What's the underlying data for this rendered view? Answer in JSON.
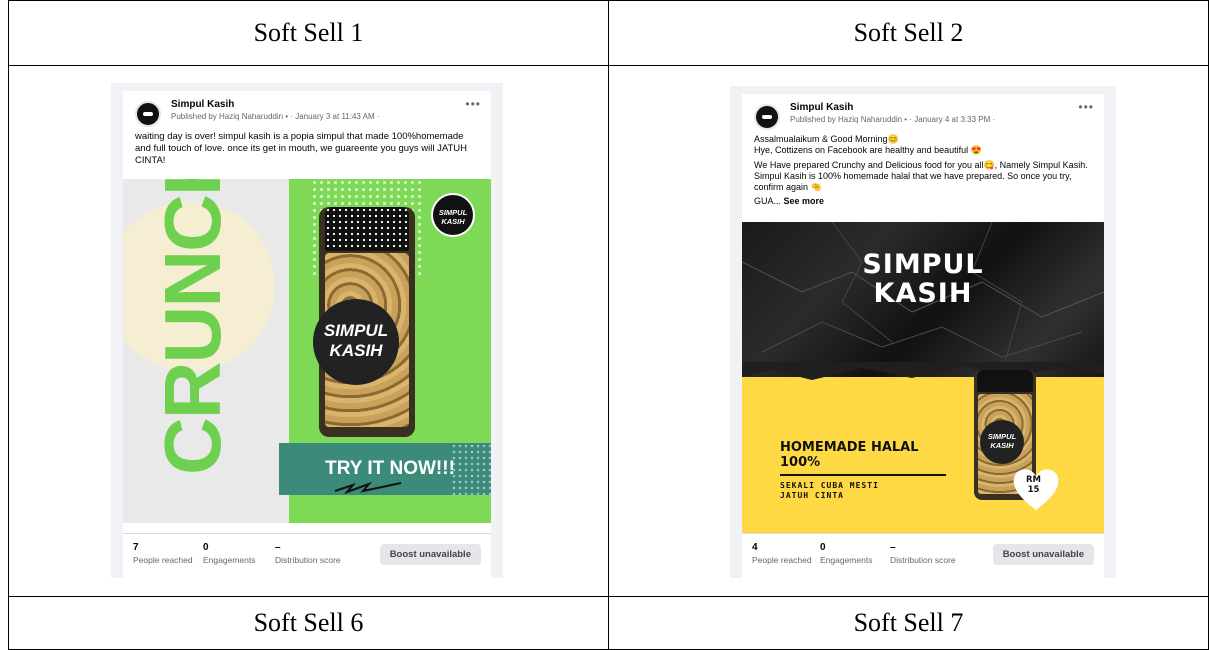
{
  "table": {
    "headers": [
      "Soft Sell 1",
      "Soft Sell 2"
    ],
    "footers": [
      "Soft Sell 6",
      "Soft Sell 7"
    ]
  },
  "posts": [
    {
      "page_name": "Simpul Kasih",
      "meta": "Published by Haziq Naharuddin • · January 3 at 11:43 AM ·",
      "text": "waiting day is over! simpul kasih is a popia simpul that made 100%homemade and full touch of love. once its get in mouth, we guareente you guys will JATUH CINTA!",
      "image": {
        "headline": "CRUNCH",
        "jar_label": "SIMPUL KASIH",
        "logo": "SIMPUL KASIH",
        "cta": "TRY IT NOW!!!"
      },
      "stats": {
        "reached": "7",
        "reached_label": "People reached",
        "engagements": "0",
        "engagements_label": "Engagements",
        "score": "–",
        "score_label": "Distribution score"
      },
      "boost_label": "Boost unavailable"
    },
    {
      "page_name": "Simpul Kasih",
      "meta": "Published by Haziq Naharuddin • · January 4 at 3:33 PM ·",
      "text_lines": [
        "Assalmualaikum & Good Morning😊",
        "Hye, Cottizens on Facebook are healthy and beautiful 😍",
        "We Have prepared Crunchy and Delicious food for you all😋, Namely Simpul Kasih. Simpul Kasih is 100% homemade halal that we have prepared. So once you try,  confirm again 🤏"
      ],
      "text_tail": "GUA...",
      "see_more": "See more",
      "image": {
        "title_line1": "SIMPUL",
        "title_line2": "KASIH",
        "homemade_line1": "HOMEMADE HALAL",
        "homemade_line2": "100%",
        "sub_line1": "SEKALI CUBA MESTI",
        "sub_line2": "JATUH CINTA",
        "jar_label": "SIMPUL KASIH",
        "price_line1": "RM",
        "price_line2": "15"
      },
      "stats": {
        "reached": "4",
        "reached_label": "People reached",
        "engagements": "0",
        "engagements_label": "Engagements",
        "score": "–",
        "score_label": "Distribution score"
      },
      "boost_label": "Boost unavailable"
    }
  ],
  "colors": {
    "facebook_gray": "#f0f2f5",
    "crunch_green": "#7ed957",
    "cta_teal": "#3c8a7a",
    "yellow": "#ffd944"
  }
}
